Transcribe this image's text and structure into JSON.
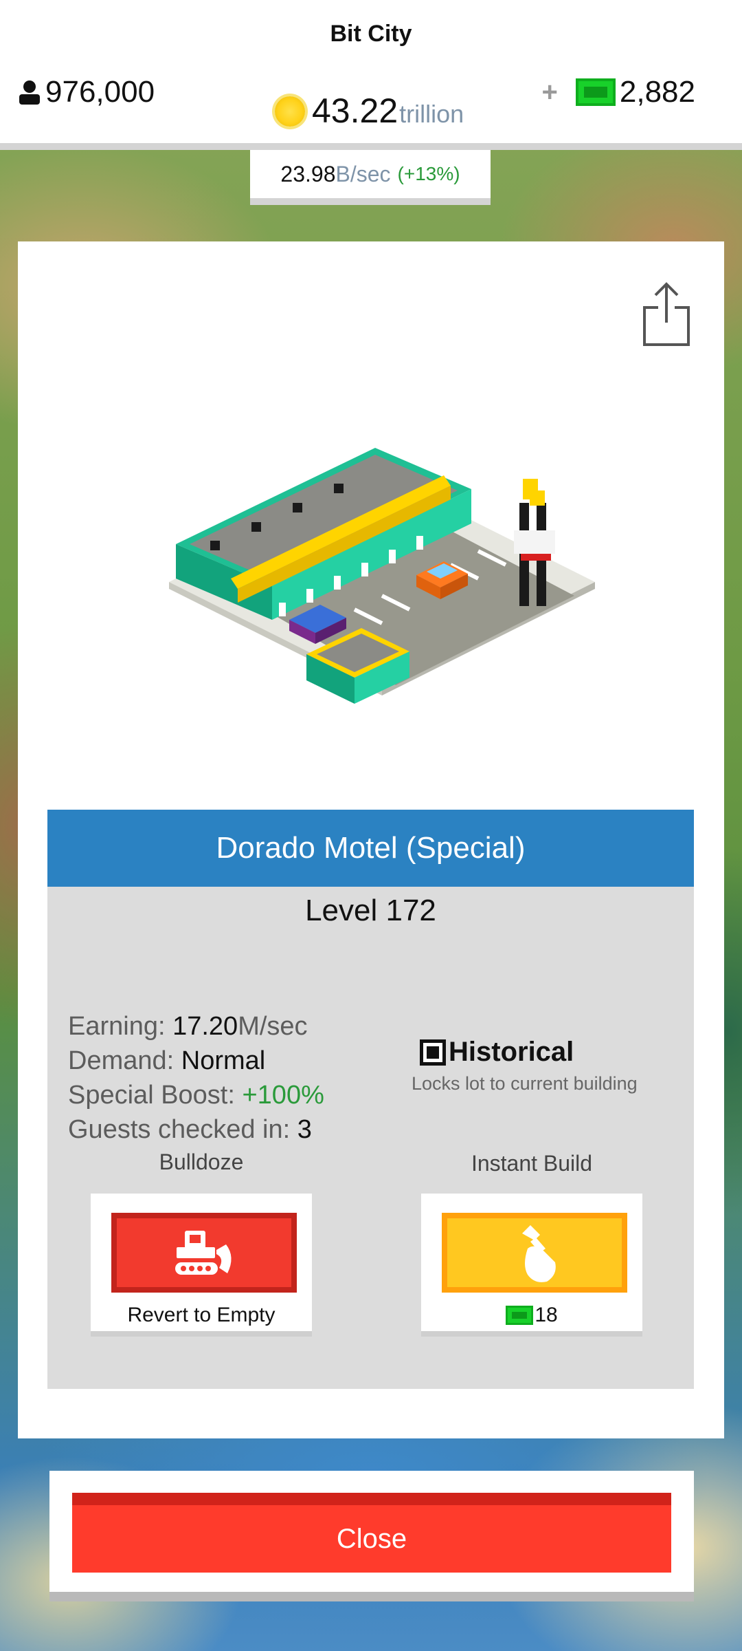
{
  "header": {
    "title": "Bit City",
    "population": "976,000",
    "money_value": "43.22",
    "money_unit": "trillion",
    "plus": "+",
    "cash": "2,882",
    "rate_value": "23.98",
    "rate_unit": "B/sec",
    "rate_boost": "(+13%)"
  },
  "building": {
    "name": "Dorado Motel (Special)",
    "level": "Level 172",
    "stats": {
      "earning_label": "Earning: ",
      "earning_value": "17.20",
      "earning_unit": "M/sec",
      "demand_label": "Demand: ",
      "demand_value": "Normal",
      "boost_label": "Special Boost: ",
      "boost_value": "+100%",
      "guests_label": "Guests checked in: ",
      "guests_value": "3"
    },
    "historical": {
      "label": "Historical",
      "description": "Locks lot to current building",
      "checked": true
    }
  },
  "actions": {
    "bulldoze_title": "Bulldoze",
    "bulldoze_caption": "Revert to Empty",
    "instant_title": "Instant Build",
    "instant_cost": "18"
  },
  "close_label": "Close",
  "icons": {
    "population": "person-icon",
    "money": "coin-icon",
    "cash": "bill-icon",
    "share": "share-icon",
    "bulldoze": "bulldozer-icon",
    "instant": "hammer-icon"
  },
  "colors": {
    "header_blue": "#2b82c2",
    "bulldoze_red": "#f23a2e",
    "instant_yellow": "#ffc820",
    "close_red": "#ff3b2c",
    "positive_green": "#2a9a3a",
    "cash_green": "#18d12a"
  }
}
